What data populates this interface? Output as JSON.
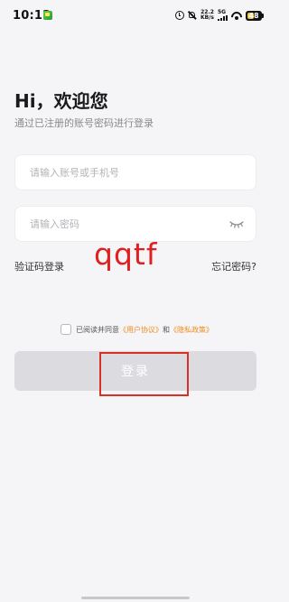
{
  "status_bar": {
    "time": "10:12",
    "net_speed_value": "22.2",
    "net_speed_unit": "KB/s",
    "signal_label": "5G",
    "battery_level": "48",
    "battery_fraction": 0.48
  },
  "login": {
    "greeting": "Hi，欢迎您",
    "subtitle": "通过已注册的账号密码进行登录",
    "account_placeholder": "请输入账号或手机号",
    "password_placeholder": "请输入密码",
    "sms_login_label": "验证码登录",
    "forgot_password_label": "忘记密码?",
    "agreement": {
      "prefix": "已阅读并同意",
      "user_agreement": "《用户协议》",
      "conjunction": "和",
      "privacy_policy": "《隐私政策》"
    },
    "login_button_label": "登录"
  },
  "annotation": {
    "text": "qqtf"
  },
  "colors": {
    "background": "#f5f5f7",
    "link_accent": "#f08c1e",
    "button_disabled": "#dcdce0",
    "annotation_red": "#e02020"
  }
}
